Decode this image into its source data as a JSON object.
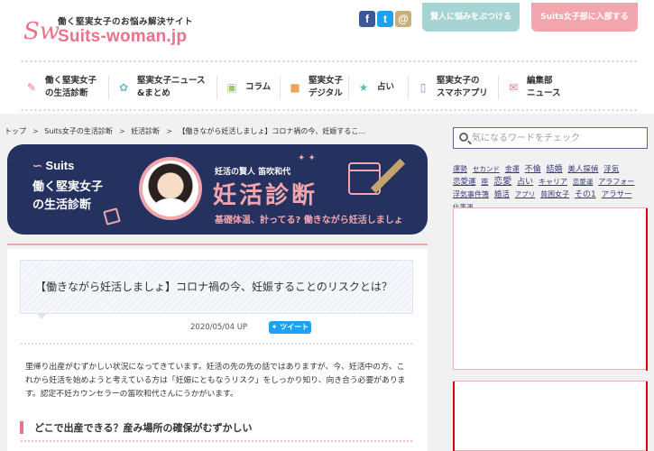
{
  "header": {
    "tagline": "働く堅実女子のお悩み解決サイト",
    "logo_text": "Suits-woman.jp",
    "logo_mark": "Sw",
    "social": {
      "facebook": "f",
      "twitter": "t",
      "instagram": "@"
    },
    "button_consult": "賢人に悩みをぶつける",
    "button_join": "Suits女子部に入部する"
  },
  "nav": {
    "items": [
      {
        "label": "働く堅実女子\nの生活診断",
        "icon": "clipboard-icon"
      },
      {
        "label": "堅実女子ニュース\n&まとめ",
        "icon": "leaf-icon"
      },
      {
        "label": "コラム",
        "icon": "book-icon"
      },
      {
        "label": "堅実女子\nデジタル",
        "icon": "bag-icon"
      },
      {
        "label": "占い",
        "icon": "star-icon"
      },
      {
        "label": "堅実女子の\nスマホアプリ",
        "icon": "smartphone-icon"
      },
      {
        "label": "編集部\nニュース",
        "icon": "chat-icon"
      }
    ]
  },
  "breadcrumb": [
    "トップ",
    "Suits女子の生活診断",
    "妊活診断",
    "【働きながら妊活しましょ】コロナ禍の今、妊娠するこ..."
  ],
  "banner": {
    "brand": "Suits",
    "sub1": "働く堅実女子",
    "sub2": "の生活診断",
    "doctor": "妊活の賢人 笛吹和代",
    "title": "妊活診断",
    "tagline": "基礎体温、計ってる? 働きながら妊活しましょ"
  },
  "article": {
    "title": "【働きながら妊活しましょ】コロナ禍の今、妊娠することのリスクとは？",
    "date": "2020/05/04 UP",
    "tweet_label": "ツイート",
    "lead": "里帰り出産がむずかしい状況になってきています。妊活の先の先の話ではありますが、今、妊活中の方、これから妊活を始めようと考えている方は「妊娠にともなうリスク」をしっかり知り、向き合う必要があります。認定不妊カウンセラーの笛吹和代さんにうかがいます。",
    "heading": "どこで出産できる？産み場所の確保がむずかしい"
  },
  "sidebar": {
    "search_placeholder": "気になるワードをチェック",
    "tags": [
      "運勢",
      "セカンド",
      "金運",
      "不倫",
      "結婚",
      "美人探偵",
      "浮気",
      "恋愛運",
      "座",
      "恋愛",
      "占い",
      "キャリア",
      "恋愛運",
      "アラフォー",
      "浮気事件簿",
      "婚活",
      "アプリ",
      "貧困女子",
      "その1",
      "アラサー",
      "仕事運"
    ]
  },
  "colors": {
    "brand_pink": "#e8738a",
    "teal_button": "#a6d4d3",
    "pink_button": "#f2a5ad",
    "banner_navy": "#25325f",
    "twitter": "#1da1f2",
    "facebook": "#3b5998"
  }
}
